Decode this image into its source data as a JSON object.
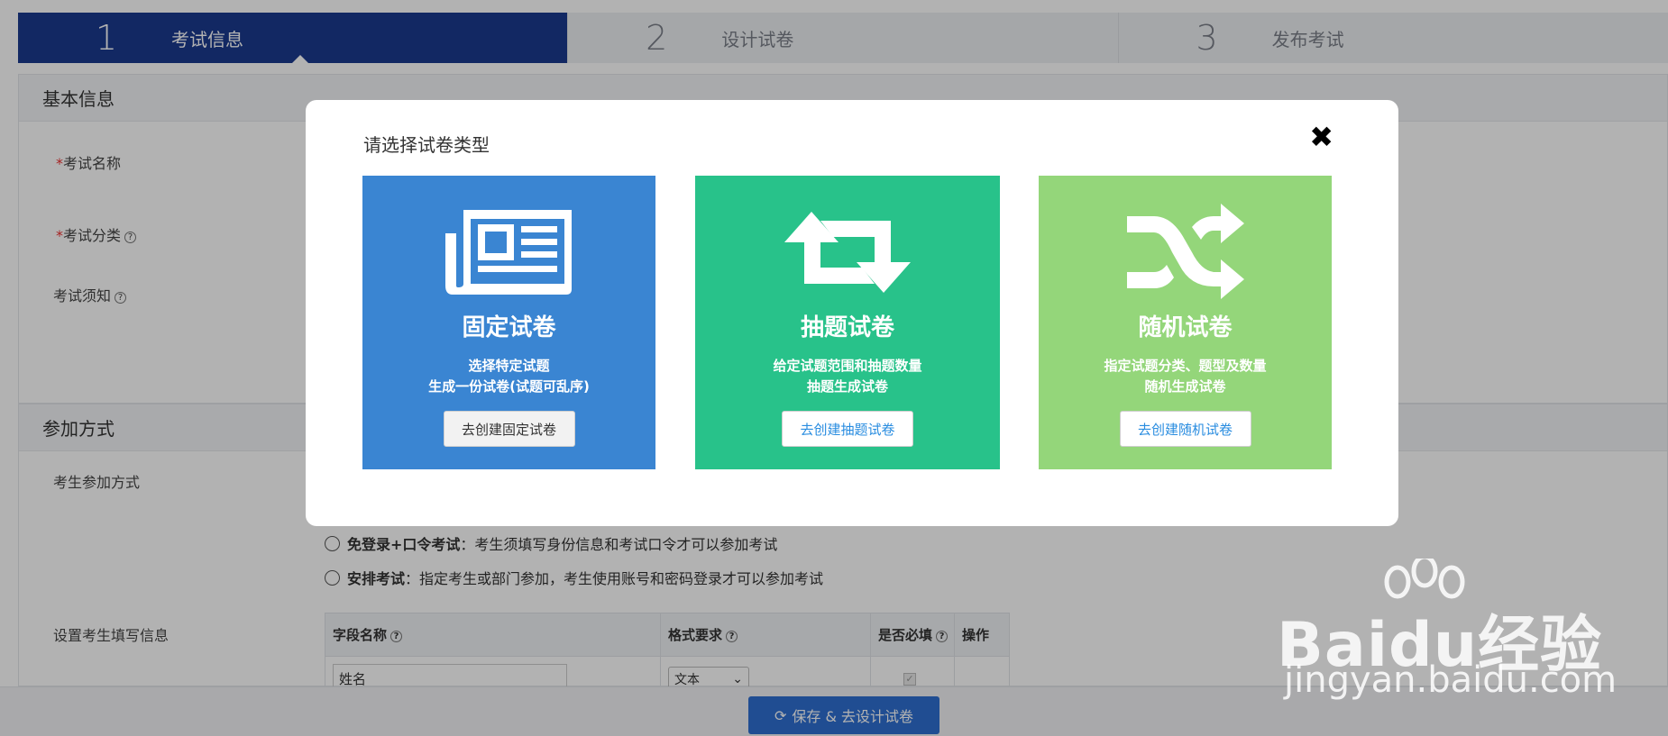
{
  "steps": [
    {
      "num": "1",
      "label": "考试信息",
      "active": true
    },
    {
      "num": "2",
      "label": "设计试卷",
      "active": false
    },
    {
      "num": "3",
      "label": "发布考试",
      "active": false
    }
  ],
  "basic_info": {
    "title": "基本信息",
    "exam_name_label": "考试名称",
    "exam_category_label": "考试分类",
    "exam_notice_label": "考试须知"
  },
  "join": {
    "title": "参加方式",
    "join_method_label": "考生参加方式",
    "option_free_login_bold": "免登录+口令考试",
    "option_free_login_desc": "：考生须填写身份信息和考试口令才可以参加考试",
    "option_arrange_bold": "安排考试",
    "option_arrange_desc": "：指定考生或部门参加，考生使用账号和密码登录才可以参加考试",
    "fill_info_label": "设置考生填写信息"
  },
  "fields_table": {
    "headers": [
      "字段名称",
      "格式要求",
      "是否必填",
      "操作"
    ],
    "rows": [
      {
        "name": "姓名",
        "format": "文本",
        "required": true
      }
    ]
  },
  "save_button": "保存 & 去设计试卷",
  "modal": {
    "title": "请选择试卷类型",
    "close_symbol": "✖",
    "cards": [
      {
        "title": "固定试卷",
        "desc1": "选择特定试题",
        "desc2": "生成一份试卷(试题可乱序)",
        "button": "去创建固定试卷",
        "color": "#3a85d2",
        "icon": "newspaper-icon"
      },
      {
        "title": "抽题试卷",
        "desc1": "给定试题范围和抽题数量",
        "desc2": "抽题生成试卷",
        "button": "去创建抽题试卷",
        "color": "#28c28a",
        "icon": "retweet-icon"
      },
      {
        "title": "随机试卷",
        "desc1": "指定试题分类、题型及数量",
        "desc2": "随机生成试卷",
        "button": "去创建随机试卷",
        "color": "#94d67a",
        "icon": "shuffle-icon"
      }
    ]
  },
  "watermark": {
    "main": "Baidu经验",
    "sub": "jingyan.baidu.com"
  }
}
